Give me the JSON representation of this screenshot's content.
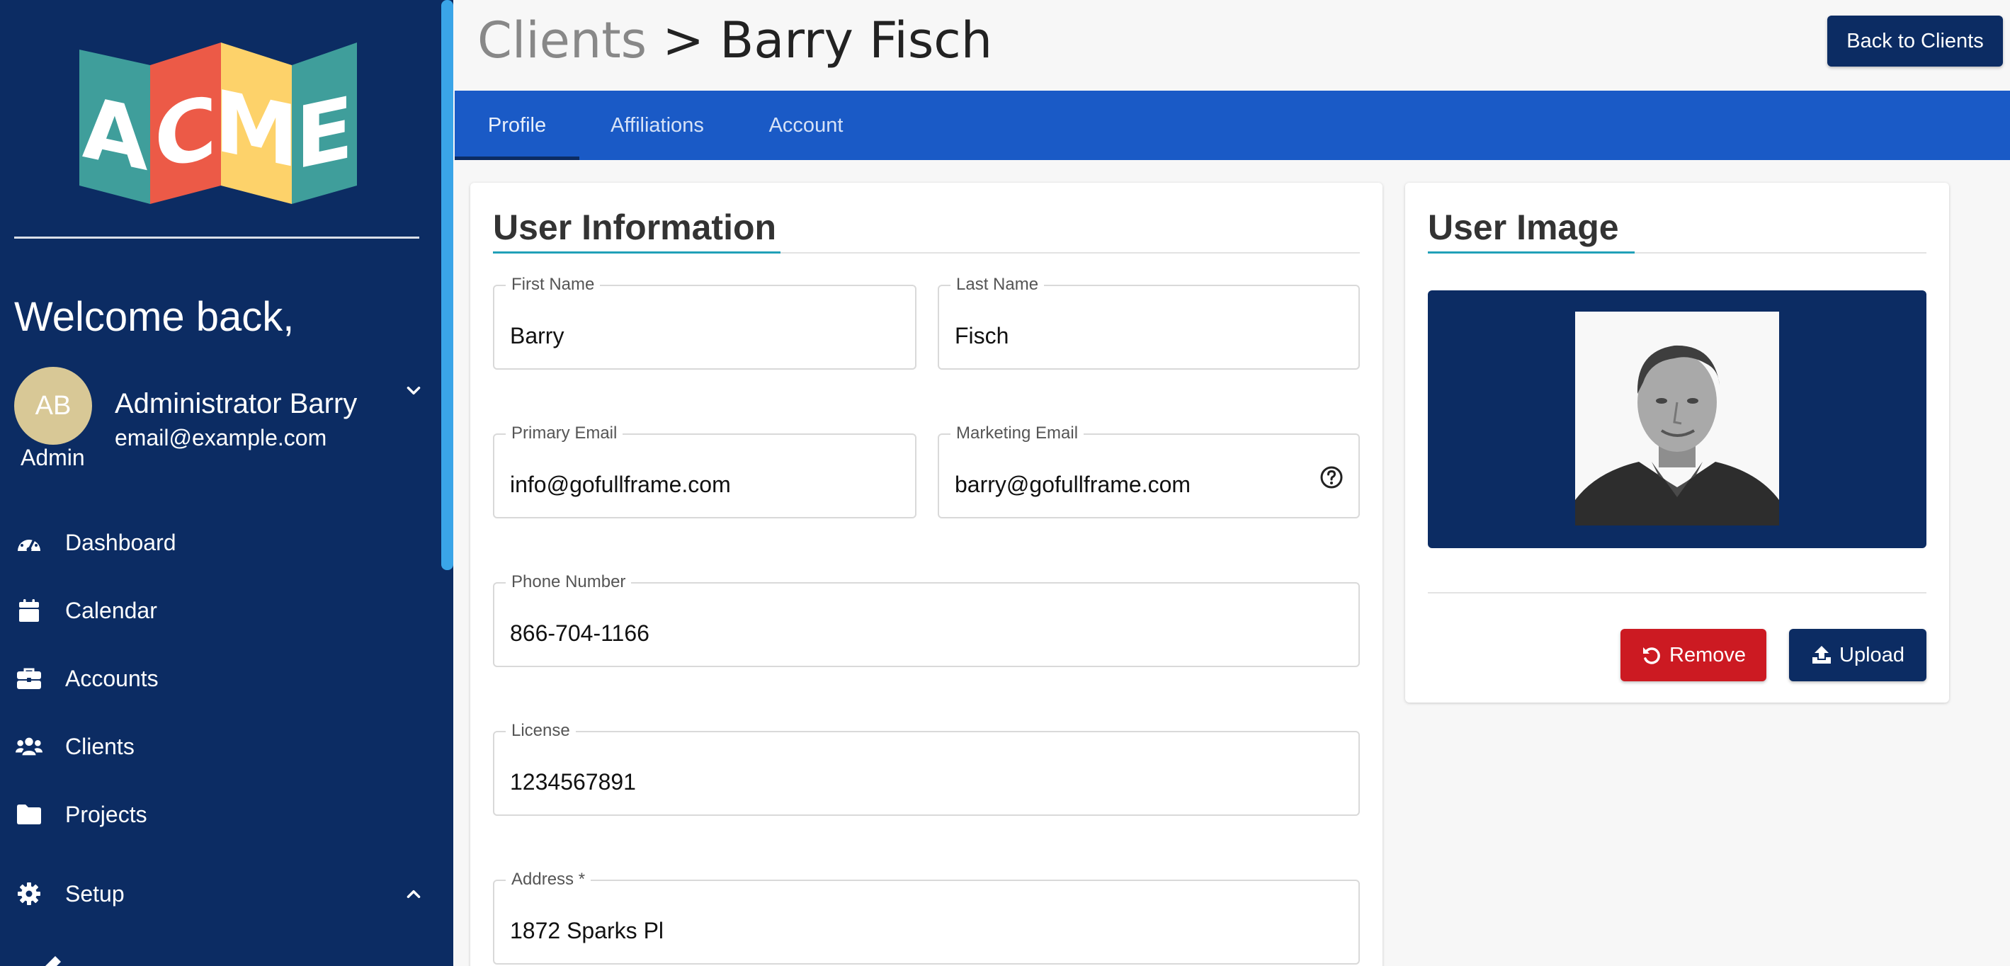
{
  "app": {
    "logo_text": "ACME"
  },
  "sidebar": {
    "welcome": "Welcome back,",
    "user": {
      "initials": "AB",
      "name": "Administrator Barry",
      "email": "email@example.com",
      "role": "Admin"
    },
    "items": [
      {
        "label": "Dashboard",
        "icon": "dashboard-icon"
      },
      {
        "label": "Calendar",
        "icon": "calendar-icon"
      },
      {
        "label": "Accounts",
        "icon": "briefcase-icon"
      },
      {
        "label": "Clients",
        "icon": "users-icon"
      },
      {
        "label": "Projects",
        "icon": "folder-icon"
      },
      {
        "label": "Setup",
        "icon": "gear-icon"
      }
    ]
  },
  "header": {
    "breadcrumb_parent": "Clients",
    "breadcrumb_separator": ">",
    "breadcrumb_current": "Barry Fisch",
    "back_button": "Back to Clients"
  },
  "tabs": [
    {
      "label": "Profile",
      "active": true
    },
    {
      "label": "Affiliations",
      "active": false
    },
    {
      "label": "Account",
      "active": false
    }
  ],
  "user_info": {
    "title": "User Information",
    "first_name": {
      "label": "First Name",
      "value": "Barry"
    },
    "last_name": {
      "label": "Last Name",
      "value": "Fisch"
    },
    "primary_email": {
      "label": "Primary Email",
      "value": "info@gofullframe.com"
    },
    "marketing_email": {
      "label": "Marketing Email",
      "value": "barry@gofullframe.com"
    },
    "phone": {
      "label": "Phone Number",
      "value": "866-704-1166"
    },
    "license": {
      "label": "License",
      "value": "1234567891"
    },
    "address": {
      "label": "Address *",
      "value": "1872 Sparks Pl"
    }
  },
  "user_image": {
    "title": "User Image",
    "remove_button": "Remove",
    "upload_button": "Upload"
  },
  "colors": {
    "sidebar_bg": "#0c2c63",
    "tab_bar": "#1a5ac6",
    "accent_teal": "#21a0b8",
    "remove_red": "#cc1a22",
    "avatar": "#d8c896"
  }
}
